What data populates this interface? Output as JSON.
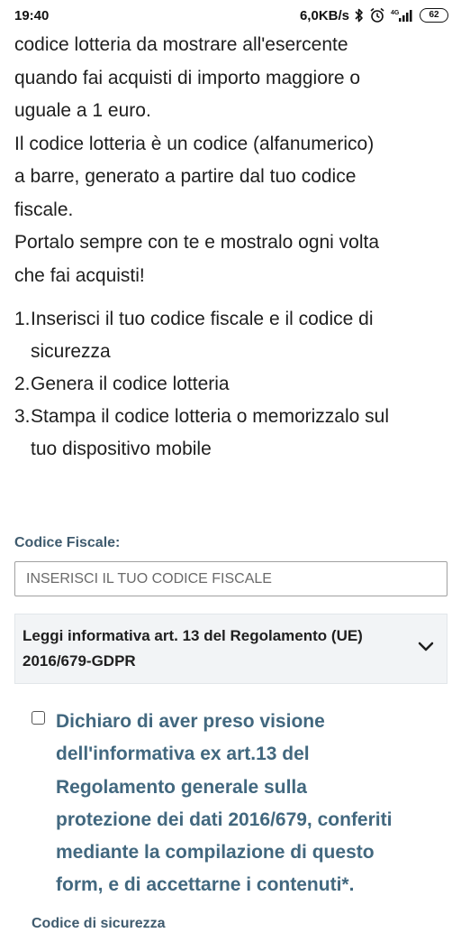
{
  "status_bar": {
    "time": "19:40",
    "network_speed": "6,0KB/s",
    "network_type": "4G",
    "battery": "62",
    "icons": [
      "bluetooth-icon",
      "alarm-icon",
      "signal-icon",
      "battery-icon"
    ]
  },
  "intro": {
    "lines": [
      "codice lotteria da mostrare all'esercente",
      "quando fai acquisti di importo maggiore o",
      "uguale a 1 euro.",
      "Il codice lotteria è un codice (alfanumerico)",
      "a barre, generato a partire dal tuo codice",
      "fiscale.",
      "Portalo sempre con te e mostralo ogni volta",
      "che fai acquisti!"
    ]
  },
  "steps": [
    {
      "num": "1.",
      "lines": [
        "Inserisci il tuo codice fiscale e il codice di",
        "sicurezza"
      ]
    },
    {
      "num": "2.",
      "lines": [
        "Genera il codice lotteria"
      ]
    },
    {
      "num": "3.",
      "lines": [
        "Stampa il codice lotteria o memorizzalo sul",
        "tuo dispositivo mobile"
      ]
    }
  ],
  "form": {
    "codice_fiscale_label": "Codice Fiscale:",
    "codice_fiscale_placeholder": "INSERISCI IL TUO CODICE FISCALE",
    "codice_fiscale_value": "",
    "informativa_title_lines": [
      "Leggi informativa art. 13 del Regolamento (UE)",
      "2016/679-GDPR"
    ],
    "consent_lines": [
      "Dichiaro di aver preso visione",
      "dell'informativa ex art.13 del",
      "Regolamento generale sulla",
      "protezione dei dati 2016/679, conferiti",
      "mediante la compilazione di questo",
      "form, e di accettarne i contenuti*."
    ],
    "consent_checked": false,
    "next_field_label": "Codice di sicurezza"
  },
  "colors": {
    "label": "#3f5b6e",
    "consent_text": "#42687f",
    "accordion_bg": "#f2f4f6",
    "body_text": "#1e1e1e"
  }
}
